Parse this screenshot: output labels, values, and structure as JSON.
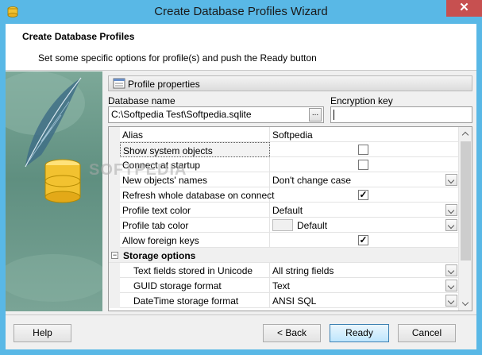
{
  "window": {
    "title": "Create Database Profiles Wizard",
    "close_label": "✕"
  },
  "header": {
    "title": "Create Database Profiles",
    "subtitle": "Set some specific options for profile(s) and push the Ready button"
  },
  "section": {
    "label": "Profile properties"
  },
  "fields": {
    "database_name_label": "Database name",
    "database_name_value": "C:\\Softpedia Test\\Softpedia.sqlite",
    "browse_label": "...",
    "encryption_key_label": "Encryption key",
    "encryption_key_value": ""
  },
  "properties": [
    {
      "name": "Alias",
      "value": "Softpedia",
      "kind": "text"
    },
    {
      "name": "Show system objects",
      "value": "",
      "kind": "checkbox",
      "checked": false
    },
    {
      "name": "Connect at startup",
      "value": "",
      "kind": "checkbox",
      "checked": false
    },
    {
      "name": "New objects' names",
      "value": "Don't change case",
      "kind": "dropdown"
    },
    {
      "name": "Refresh whole database on connect",
      "value": "",
      "kind": "checkbox",
      "checked": true
    },
    {
      "name": "Profile text color",
      "value": "Default",
      "kind": "dropdown"
    },
    {
      "name": "Profile tab color",
      "value": "Default",
      "kind": "color-dropdown"
    },
    {
      "name": "Allow foreign keys",
      "value": "",
      "kind": "checkbox",
      "checked": true
    }
  ],
  "storage_group": {
    "label": "Storage options",
    "toggle": "−",
    "items": [
      {
        "name": "Text fields stored in Unicode",
        "value": "All string fields"
      },
      {
        "name": "GUID storage format",
        "value": "Text"
      },
      {
        "name": "DateTime storage format",
        "value": "ANSI SQL"
      }
    ]
  },
  "buttons": {
    "help": "Help",
    "back": "< Back",
    "ready": "Ready",
    "cancel": "Cancel"
  },
  "watermark": "SOFTPEDIA",
  "colors": {
    "titlebar": "#59b8e6",
    "close": "#c75050",
    "art_panel": "#6e9b8c"
  }
}
